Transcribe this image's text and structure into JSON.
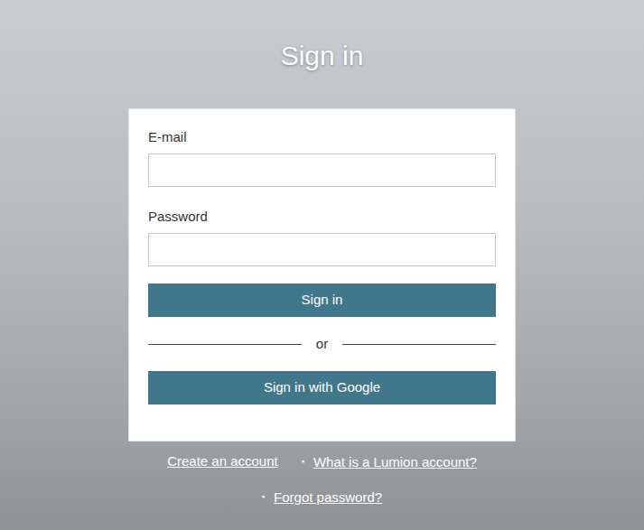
{
  "page": {
    "title": "Sign in"
  },
  "form": {
    "fields": [
      {
        "label": "E-mail",
        "type": "email"
      },
      {
        "label": "Password",
        "type": "password"
      }
    ],
    "buttons": [
      "Sign in",
      "Sign in with Google"
    ],
    "divider": "or"
  },
  "links": [
    {
      "text": "Create an account",
      "bullet": ""
    },
    {
      "text": "What is a Lumion account?",
      "bullet": "▪"
    },
    {
      "text": "Forgot password?",
      "bullet": "▪"
    }
  ]
}
